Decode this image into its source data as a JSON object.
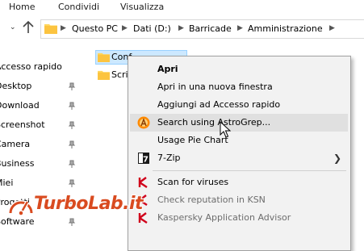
{
  "ribbon": {
    "tabs": [
      "Home",
      "Condividi",
      "Visualizza"
    ]
  },
  "address": {
    "crumbs": [
      "Questo PC",
      "Dati (D:)",
      "Barricade",
      "Amministrazione"
    ]
  },
  "navpane": {
    "items": [
      {
        "label": "Accesso rapido",
        "pinned": false
      },
      {
        "label": "Desktop",
        "pinned": true
      },
      {
        "label": "Download",
        "pinned": true
      },
      {
        "label": "Screenshot",
        "pinned": true
      },
      {
        "label": "Camera",
        "pinned": true
      },
      {
        "label": "Business",
        "pinned": true
      },
      {
        "label": "Miei",
        "pinned": true
      },
      {
        "label": "Progetti",
        "pinned": true
      },
      {
        "label": "Software",
        "pinned": true
      }
    ]
  },
  "files": [
    {
      "name": "Conf",
      "selected": true
    },
    {
      "name": "Scripts",
      "selected": false
    }
  ],
  "context_menu": {
    "items": [
      {
        "label": "Apri",
        "bold": true
      },
      {
        "label": "Apri in una nuova finestra"
      },
      {
        "label": "Aggiungi ad Accesso rapido"
      },
      {
        "label": "Search using AstroGrep...",
        "icon": "astrogrep-icon",
        "hover": true
      },
      {
        "label": "Usage Pie Chart"
      },
      {
        "label": "7-Zip",
        "icon": "7zip-icon",
        "submenu": true
      },
      {
        "label": "Scan for viruses",
        "icon": "kaspersky-icon"
      },
      {
        "label": "Check reputation in KSN",
        "icon": "kaspersky-icon",
        "disabled": true
      },
      {
        "label": "Kaspersky Application Advisor",
        "icon": "kaspersky-icon",
        "disabled": true
      }
    ]
  },
  "watermark": {
    "text": "TurboLab.it"
  },
  "colors": {
    "selection_bg": "#cce8ff",
    "menu_bg": "#f2f2f2",
    "menu_hover": "#e0e0e0",
    "kaspersky_red": "#d0021b",
    "astrogrep_orange": "#ff8a00",
    "watermark_orange": "#d94b20"
  }
}
